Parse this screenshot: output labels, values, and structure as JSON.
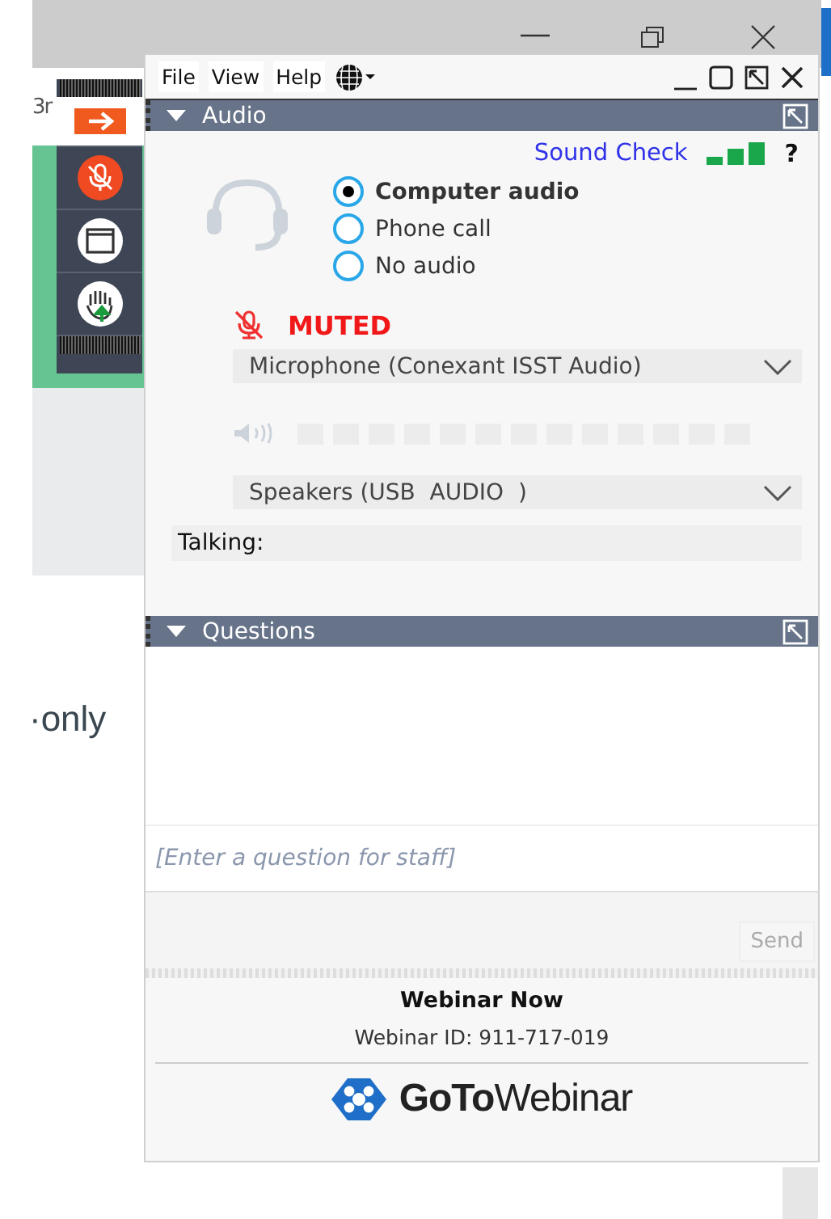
{
  "background": {
    "tab_fragment": "3r",
    "text_fragment": "·only"
  },
  "toolbar": {
    "items": [
      {
        "kind": "arrow"
      },
      {
        "kind": "mute"
      },
      {
        "kind": "screen"
      },
      {
        "kind": "hand"
      }
    ]
  },
  "menu": [
    "File",
    "View",
    "Help"
  ],
  "audio": {
    "title": "Audio",
    "expanded": true,
    "sound_check": "Sound Check",
    "help": "?",
    "options": [
      {
        "label": "Computer audio",
        "selected": true
      },
      {
        "label": "Phone call",
        "selected": false
      },
      {
        "label": "No audio",
        "selected": false
      }
    ],
    "status": "MUTED",
    "microphone": "Microphone (Conexant ISST Audio)",
    "speaker_meter": {
      "level": 0
    },
    "speakers": "Speakers (USB  AUDIO  )",
    "talking": "Talking:"
  },
  "questions": {
    "title": "Questions",
    "expanded": true,
    "placeholder": "[Enter a question for staff]",
    "send": {
      "label": "Send",
      "disabled": true
    }
  },
  "footer": {
    "title": "Webinar Now",
    "webinar_id": "Webinar ID: 911-717-019",
    "logo": "**GoTo**Webinar"
  }
}
